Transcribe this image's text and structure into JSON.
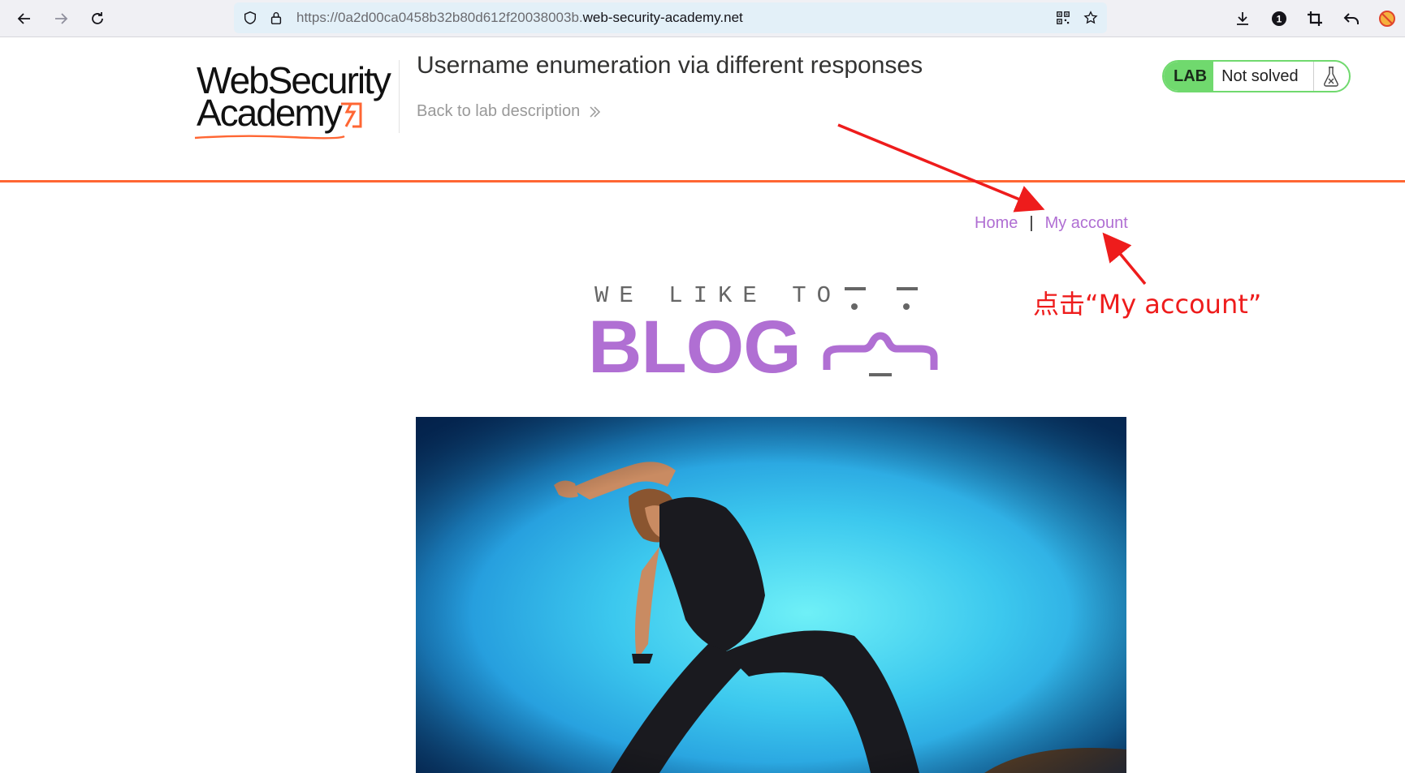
{
  "browser": {
    "url_scheme": "https://",
    "url_subdomain": "0a2d00ca0458b32b80d612f20038003b.",
    "url_host": "web-security-academy.net",
    "icons": [
      "back-icon",
      "forward-icon",
      "reload-icon",
      "shield-icon",
      "lock-icon",
      "qr-code-icon",
      "bookmark-star-icon",
      "download-icon",
      "extension-icon",
      "crop-icon",
      "undo-icon",
      "blocker-icon"
    ],
    "badge_count": "1"
  },
  "lab_header": {
    "logo_line1": "WebSecurity",
    "logo_line2": "Academy",
    "title": "Username enumeration via different responses",
    "back_link": "Back to lab description",
    "lab_badge": "LAB",
    "lab_state": "Not solved"
  },
  "blog_nav": {
    "home": "Home",
    "separator": "|",
    "my_account": "My account"
  },
  "blog_header": {
    "tagline": "WE LIKE TO",
    "word": "BLOG"
  },
  "annotation": {
    "text": "点击“My account”"
  },
  "colors": {
    "accent_orange": "#ff6633",
    "link_purple": "#b06fd3",
    "lab_green": "#70d96e",
    "annotation_red": "#ee1c1c"
  }
}
